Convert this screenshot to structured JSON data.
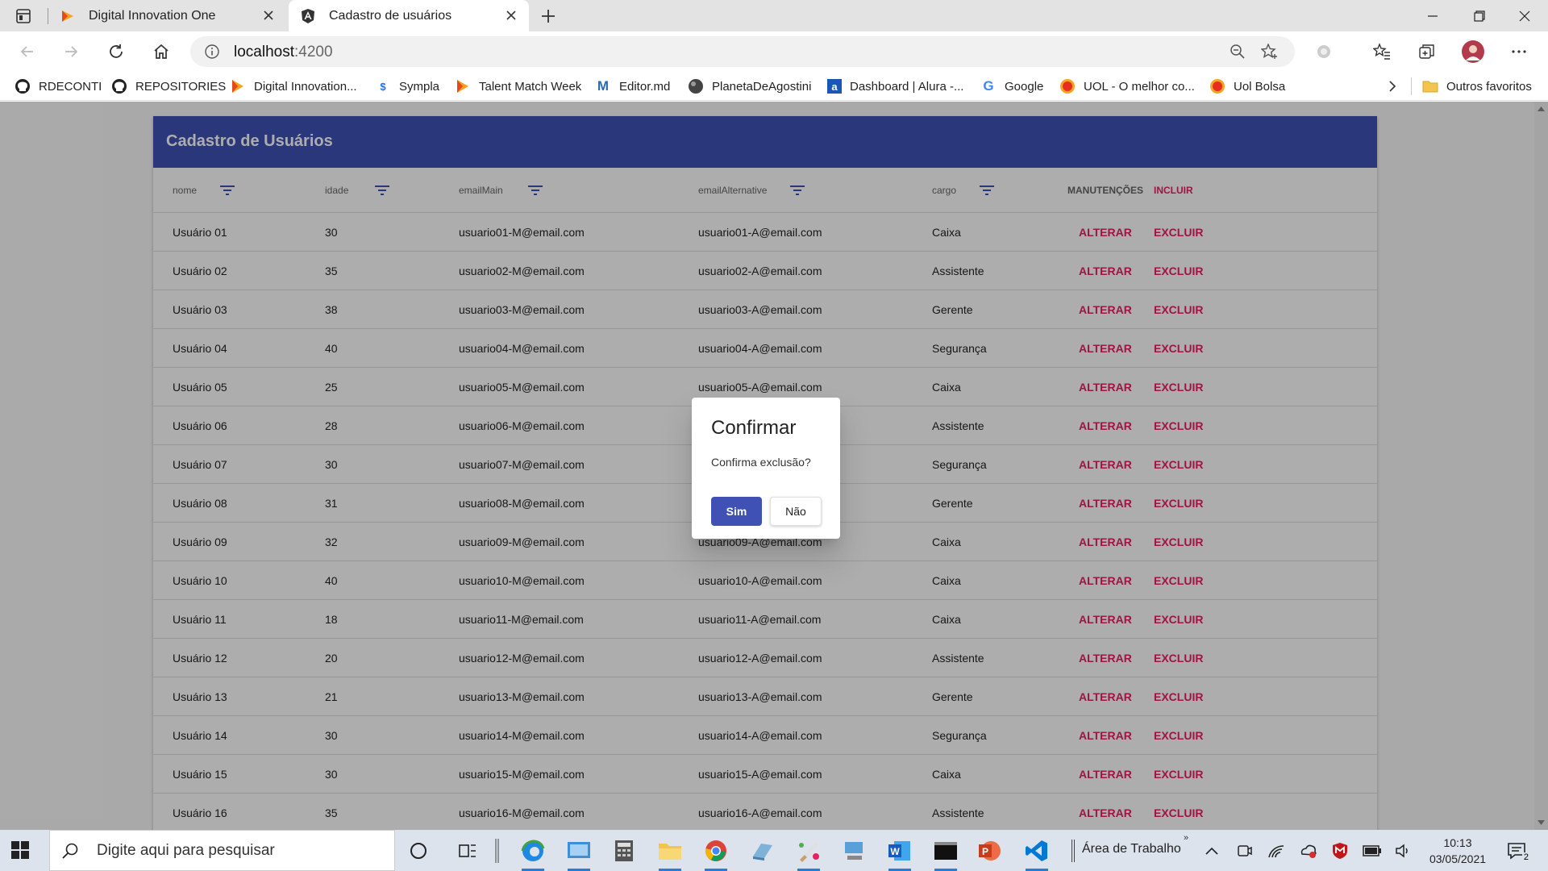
{
  "browser": {
    "tabs": [
      {
        "label": "Digital Innovation One",
        "active": false
      },
      {
        "label": "Cadastro de usuários",
        "active": true
      }
    ],
    "url_host": "localhost",
    "url_port": ":4200",
    "bookmarks": [
      {
        "label": "RDECONTI",
        "icon": "github-icon"
      },
      {
        "label": "REPOSITORIES",
        "icon": "github-icon"
      },
      {
        "label": "Digital Innovation...",
        "icon": "dio-icon"
      },
      {
        "label": "Sympla",
        "icon": "sympla-icon"
      },
      {
        "label": "Talent Match Week",
        "icon": "dio-icon"
      },
      {
        "label": "Editor.md",
        "icon": "editor-md-icon"
      },
      {
        "label": "PlanetaDeAgostini",
        "icon": "planeta-icon"
      },
      {
        "label": "Dashboard | Alura -...",
        "icon": "alura-icon"
      },
      {
        "label": "Google",
        "icon": "google-icon"
      },
      {
        "label": "UOL - O melhor co...",
        "icon": "uol-icon"
      },
      {
        "label": "Uol Bolsa",
        "icon": "uol-icon"
      }
    ],
    "other_favorites": "Outros favoritos"
  },
  "page": {
    "title": "Cadastro de Usuários",
    "columns": {
      "nome": "nome",
      "idade": "idade",
      "emailMain": "emailMain",
      "emailAlternative": "emailAlternative",
      "cargo": "cargo",
      "manutencoes": "MANUTENÇÕES",
      "incluir": "INCLUIR"
    },
    "action_alterar": "ALTERAR",
    "action_excluir": "EXCLUIR",
    "rows": [
      {
        "nome": "Usuário 01",
        "idade": "30",
        "emailMain": "usuario01-M@email.com",
        "emailAlternative": "usuario01-A@email.com",
        "cargo": "Caixa"
      },
      {
        "nome": "Usuário 02",
        "idade": "35",
        "emailMain": "usuario02-M@email.com",
        "emailAlternative": "usuario02-A@email.com",
        "cargo": "Assistente"
      },
      {
        "nome": "Usuário 03",
        "idade": "38",
        "emailMain": "usuario03-M@email.com",
        "emailAlternative": "usuario03-A@email.com",
        "cargo": "Gerente"
      },
      {
        "nome": "Usuário 04",
        "idade": "40",
        "emailMain": "usuario04-M@email.com",
        "emailAlternative": "usuario04-A@email.com",
        "cargo": "Segurança"
      },
      {
        "nome": "Usuário 05",
        "idade": "25",
        "emailMain": "usuario05-M@email.com",
        "emailAlternative": "usuario05-A@email.com",
        "cargo": "Caixa"
      },
      {
        "nome": "Usuário 06",
        "idade": "28",
        "emailMain": "usuario06-M@email.com",
        "emailAlternative": "",
        "cargo": "Assistente"
      },
      {
        "nome": "Usuário 07",
        "idade": "30",
        "emailMain": "usuario07-M@email.com",
        "emailAlternative": "",
        "cargo": "Segurança"
      },
      {
        "nome": "Usuário 08",
        "idade": "31",
        "emailMain": "usuario08-M@email.com",
        "emailAlternative": "",
        "cargo": "Gerente"
      },
      {
        "nome": "Usuário 09",
        "idade": "32",
        "emailMain": "usuario09-M@email.com",
        "emailAlternative": "usuario09-A@email.com",
        "cargo": "Caixa"
      },
      {
        "nome": "Usuário 10",
        "idade": "40",
        "emailMain": "usuario10-M@email.com",
        "emailAlternative": "usuario10-A@email.com",
        "cargo": "Caixa"
      },
      {
        "nome": "Usuário 11",
        "idade": "18",
        "emailMain": "usuario11-M@email.com",
        "emailAlternative": "usuario11-A@email.com",
        "cargo": "Caixa"
      },
      {
        "nome": "Usuário 12",
        "idade": "20",
        "emailMain": "usuario12-M@email.com",
        "emailAlternative": "usuario12-A@email.com",
        "cargo": "Assistente"
      },
      {
        "nome": "Usuário 13",
        "idade": "21",
        "emailMain": "usuario13-M@email.com",
        "emailAlternative": "usuario13-A@email.com",
        "cargo": "Gerente"
      },
      {
        "nome": "Usuário 14",
        "idade": "30",
        "emailMain": "usuario14-M@email.com",
        "emailAlternative": "usuario14-A@email.com",
        "cargo": "Segurança"
      },
      {
        "nome": "Usuário 15",
        "idade": "30",
        "emailMain": "usuario15-M@email.com",
        "emailAlternative": "usuario15-A@email.com",
        "cargo": "Caixa"
      },
      {
        "nome": "Usuário 16",
        "idade": "35",
        "emailMain": "usuario16-M@email.com",
        "emailAlternative": "usuario16-A@email.com",
        "cargo": "Assistente"
      }
    ]
  },
  "dialog": {
    "title": "Confirmar",
    "message": "Confirma exclusão?",
    "yes": "Sim",
    "no": "Não"
  },
  "taskbar": {
    "search_placeholder": "Digite aqui para pesquisar",
    "desktop_label": "Área de Trabalho",
    "time": "10:13",
    "date": "03/05/2021",
    "notification_count": "2"
  },
  "colors": {
    "primary": "#3f51b5",
    "accent": "#e91e63"
  }
}
